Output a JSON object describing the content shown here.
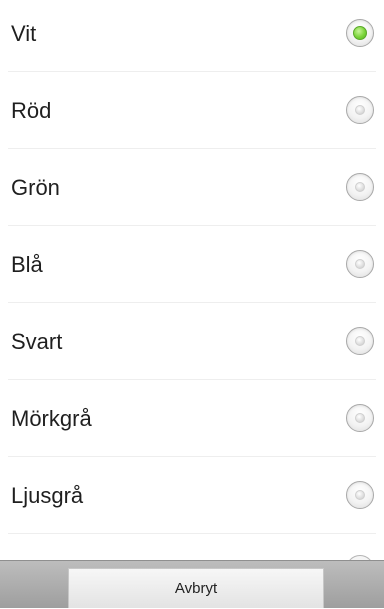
{
  "options": [
    {
      "label": "Vit",
      "checked": true
    },
    {
      "label": "Röd",
      "checked": false
    },
    {
      "label": "Grön",
      "checked": false
    },
    {
      "label": "Blå",
      "checked": false
    },
    {
      "label": "Svart",
      "checked": false
    },
    {
      "label": "Mörkgrå",
      "checked": false
    },
    {
      "label": "Ljusgrå",
      "checked": false
    }
  ],
  "footer": {
    "cancel_label": "Avbryt"
  },
  "colors": {
    "selected": "#7bd43a",
    "footer_bar": "#a8a8a8"
  }
}
